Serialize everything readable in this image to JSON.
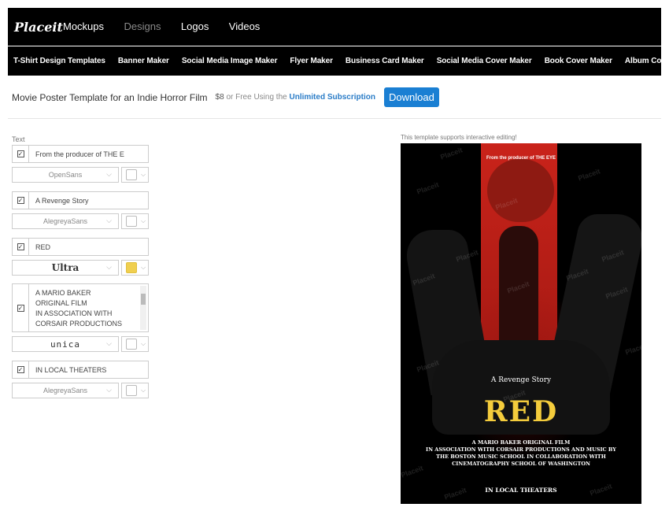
{
  "brand": {
    "logo": "Placeit"
  },
  "topnav": [
    "Mockups",
    "Designs",
    "Logos",
    "Videos"
  ],
  "subnav": [
    "T-Shirt Design Templates",
    "Banner Maker",
    "Social Media Image Maker",
    "Flyer Maker",
    "Business Card Maker",
    "Social Media Cover Maker",
    "Book Cover Maker",
    "Album Cover Maker"
  ],
  "page": {
    "title": "Movie Poster Template for an Indie Horror Film",
    "price": "$8",
    "price_or": "or Free Using the",
    "subscription": "Unlimited Subscription",
    "download": "Download"
  },
  "editor": {
    "section_label": "Text",
    "fields": [
      {
        "value": "From the producer of THE E",
        "font": "OpenSans",
        "color": "#ffffff",
        "checked": true
      },
      {
        "value": "A Revenge Story",
        "font": "AlegreyaSans",
        "color": "#ffffff",
        "checked": true
      },
      {
        "value": "RED",
        "font": "Ultra",
        "color": "#f0cf4f",
        "checked": true
      },
      {
        "value_lines": [
          "A MARIO BAKER",
          "ORIGINAL FILM",
          "IN ASSOCIATION WITH",
          "CORSAIR PRODUCTIONS"
        ],
        "font": "unica",
        "color": "#ffffff",
        "checked": true
      },
      {
        "value": "IN LOCAL THEATERS",
        "font": "AlegreyaSans",
        "color": "#ffffff",
        "checked": true
      }
    ]
  },
  "preview": {
    "support_note": "This template supports interactive editing!",
    "producer": "From the producer of THE EYE",
    "tagline": "A Revenge Story",
    "headline": "RED",
    "credits": [
      "A MARIO BAKER ORIGINAL FILM",
      "IN ASSOCIATION WITH CORSAIR PRODUCTIONS AND MUSIC BY",
      "THE BOSTON MUSIC SCHOOL IN COLLABORATION WITH",
      "CINEMATOGRAPHY SCHOOL OF WASHINGTON"
    ],
    "footer": "IN LOCAL THEATERS",
    "watermark": "Placeit"
  }
}
